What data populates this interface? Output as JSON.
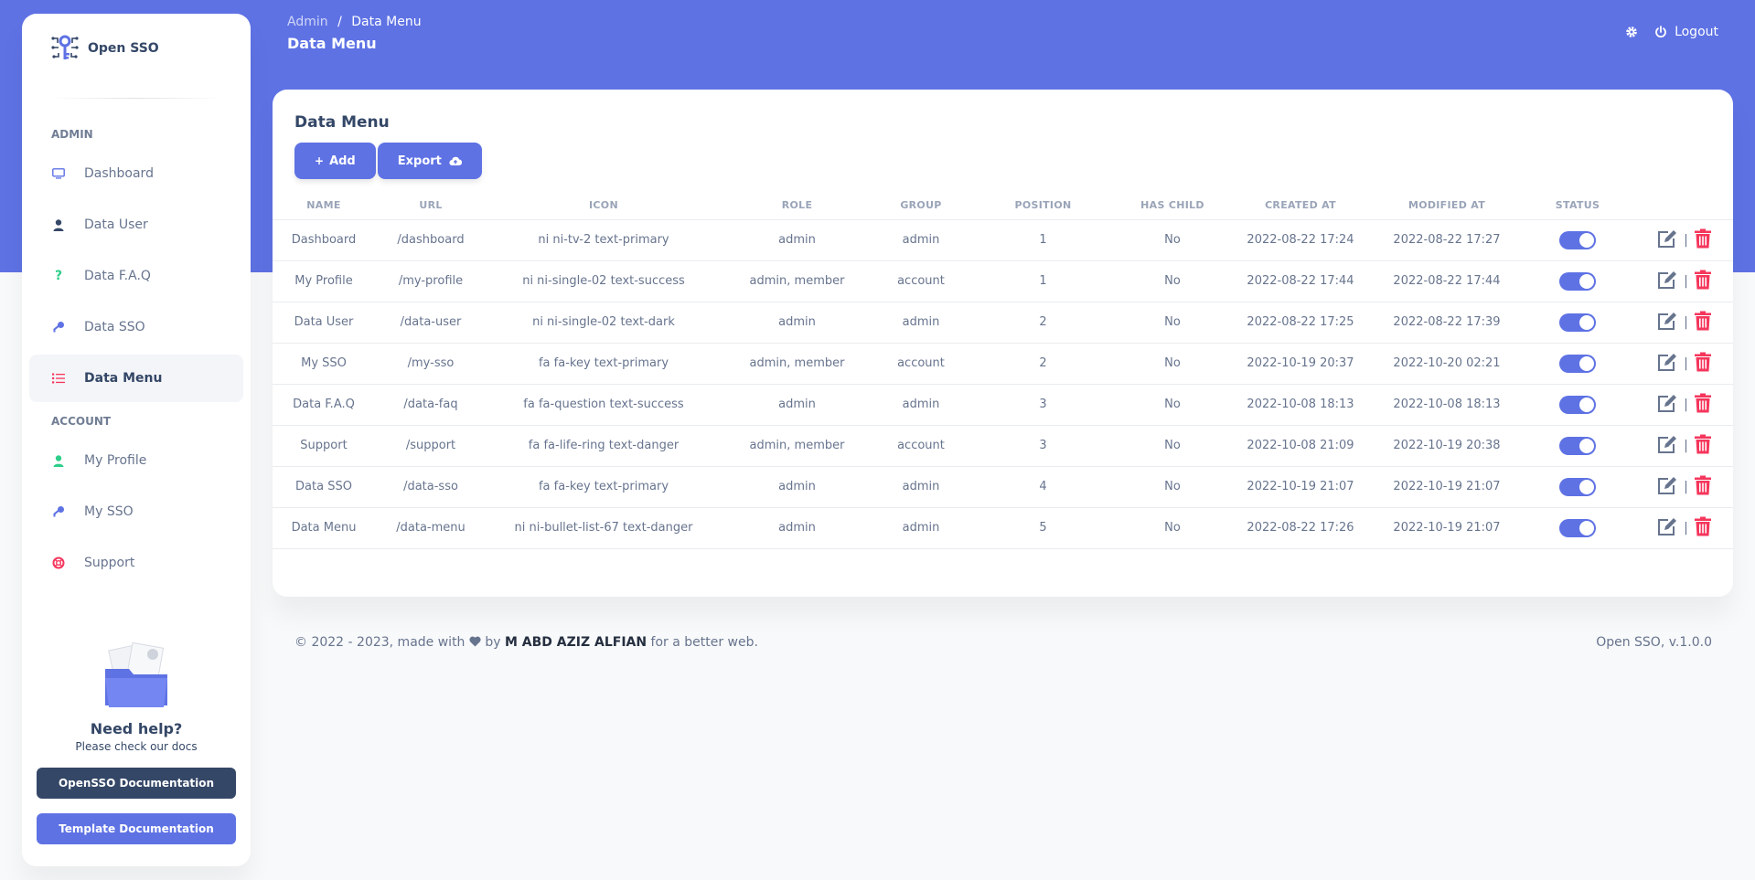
{
  "brand": {
    "name": "Open SSO"
  },
  "sidebar": {
    "sections": [
      {
        "title": "ADMIN",
        "items": [
          {
            "label": "Dashboard",
            "icon": "tv-icon",
            "color": "#5e72e4"
          },
          {
            "label": "Data User",
            "icon": "user-icon",
            "color": "#344767"
          },
          {
            "label": "Data F.A.Q",
            "icon": "question-icon",
            "color": "#2dce89"
          },
          {
            "label": "Data SSO",
            "icon": "key-icon",
            "color": "#5e72e4"
          },
          {
            "label": "Data Menu",
            "icon": "bullet-list-icon",
            "color": "#f5365c",
            "active": true
          }
        ]
      },
      {
        "title": "ACCOUNT",
        "items": [
          {
            "label": "My Profile",
            "icon": "user-icon",
            "color": "#2dce89"
          },
          {
            "label": "My SSO",
            "icon": "key-icon",
            "color": "#5e72e4"
          },
          {
            "label": "Support",
            "icon": "life-ring-icon",
            "color": "#f5365c"
          }
        ]
      }
    ],
    "help": {
      "title": "Need help?",
      "subtitle": "Please check our docs",
      "doc_button": "OpenSSO Documentation",
      "template_button": "Template Documentation"
    }
  },
  "header": {
    "breadcrumb_root": "Admin",
    "breadcrumb_sep": "/",
    "breadcrumb_current": "Data Menu",
    "title": "Data Menu",
    "logout_label": "Logout"
  },
  "card": {
    "title": "Data Menu",
    "add_label": "Add",
    "export_label": "Export"
  },
  "table": {
    "columns": [
      "Name",
      "URL",
      "Icon",
      "Role",
      "Group",
      "Position",
      "Has Child",
      "Created At",
      "Modified At",
      "Status",
      ""
    ],
    "rows": [
      {
        "name": "Dashboard",
        "url": "/dashboard",
        "icon": "ni ni-tv-2 text-primary",
        "role": "admin",
        "group": "admin",
        "position": "1",
        "has_child": "No",
        "created": "2022-08-22 17:24",
        "modified": "2022-08-22 17:27"
      },
      {
        "name": "My Profile",
        "url": "/my-profile",
        "icon": "ni ni-single-02 text-success",
        "role": "admin, member",
        "group": "account",
        "position": "1",
        "has_child": "No",
        "created": "2022-08-22 17:44",
        "modified": "2022-08-22 17:44"
      },
      {
        "name": "Data User",
        "url": "/data-user",
        "icon": "ni ni-single-02 text-dark",
        "role": "admin",
        "group": "admin",
        "position": "2",
        "has_child": "No",
        "created": "2022-08-22 17:25",
        "modified": "2022-08-22 17:39"
      },
      {
        "name": "My SSO",
        "url": "/my-sso",
        "icon": "fa fa-key text-primary",
        "role": "admin, member",
        "group": "account",
        "position": "2",
        "has_child": "No",
        "created": "2022-10-19 20:37",
        "modified": "2022-10-20 02:21"
      },
      {
        "name": "Data F.A.Q",
        "url": "/data-faq",
        "icon": "fa fa-question text-success",
        "role": "admin",
        "group": "admin",
        "position": "3",
        "has_child": "No",
        "created": "2022-10-08 18:13",
        "modified": "2022-10-08 18:13"
      },
      {
        "name": "Support",
        "url": "/support",
        "icon": "fa fa-life-ring text-danger",
        "role": "admin, member",
        "group": "account",
        "position": "3",
        "has_child": "No",
        "created": "2022-10-08 21:09",
        "modified": "2022-10-19 20:38"
      },
      {
        "name": "Data SSO",
        "url": "/data-sso",
        "icon": "fa fa-key text-primary",
        "role": "admin",
        "group": "admin",
        "position": "4",
        "has_child": "No",
        "created": "2022-10-19 21:07",
        "modified": "2022-10-19 21:07"
      },
      {
        "name": "Data Menu",
        "url": "/data-menu",
        "icon": "ni ni-bullet-list-67 text-danger",
        "role": "admin",
        "group": "admin",
        "position": "5",
        "has_child": "No",
        "created": "2022-08-22 17:26",
        "modified": "2022-10-19 21:07"
      }
    ]
  },
  "footer": {
    "prefix": "© 2022 - 2023, made with",
    "by": "by",
    "author": "M ABD AZIZ ALFIAN",
    "suffix": "for a better web.",
    "version": "Open SSO, v.1.0.0"
  },
  "colors": {
    "primary": "#5e72e4",
    "danger": "#f5365c",
    "success": "#2dce89",
    "dark": "#344767"
  }
}
